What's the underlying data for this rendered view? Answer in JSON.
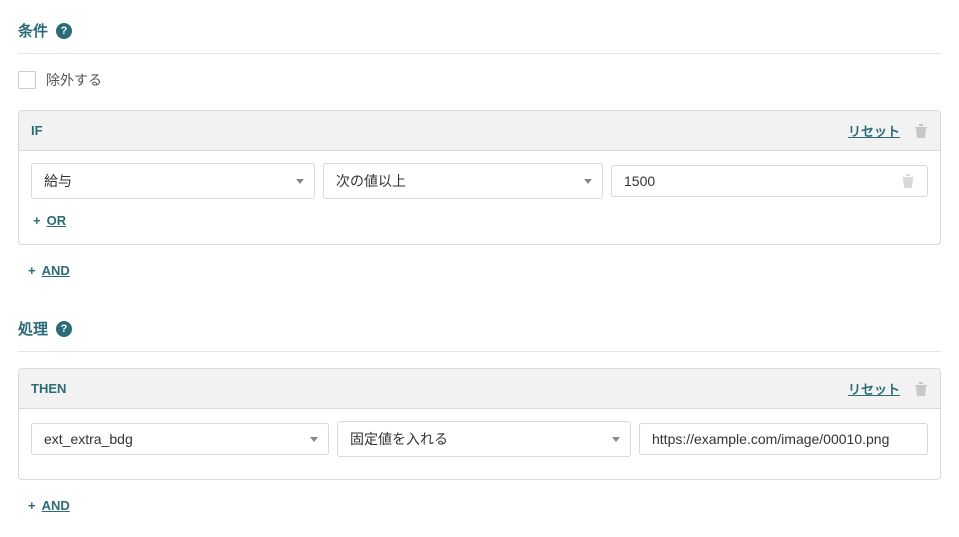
{
  "sections": {
    "condition": {
      "title": "条件",
      "help": "?"
    },
    "process": {
      "title": "処理",
      "help": "?"
    }
  },
  "exclude": {
    "label": "除外する",
    "checked": false
  },
  "ifBlock": {
    "label": "IF",
    "reset": "リセット",
    "row": {
      "field": "給与",
      "operator": "次の値以上",
      "value": "1500"
    },
    "orBtn": "OR",
    "andBtn": "AND"
  },
  "thenBlock": {
    "label": "THEN",
    "reset": "リセット",
    "row": {
      "target": "ext_extra_bdg",
      "action": "固定値を入れる",
      "value": "https://example.com/image/00010.png"
    },
    "andBtn": "AND"
  }
}
